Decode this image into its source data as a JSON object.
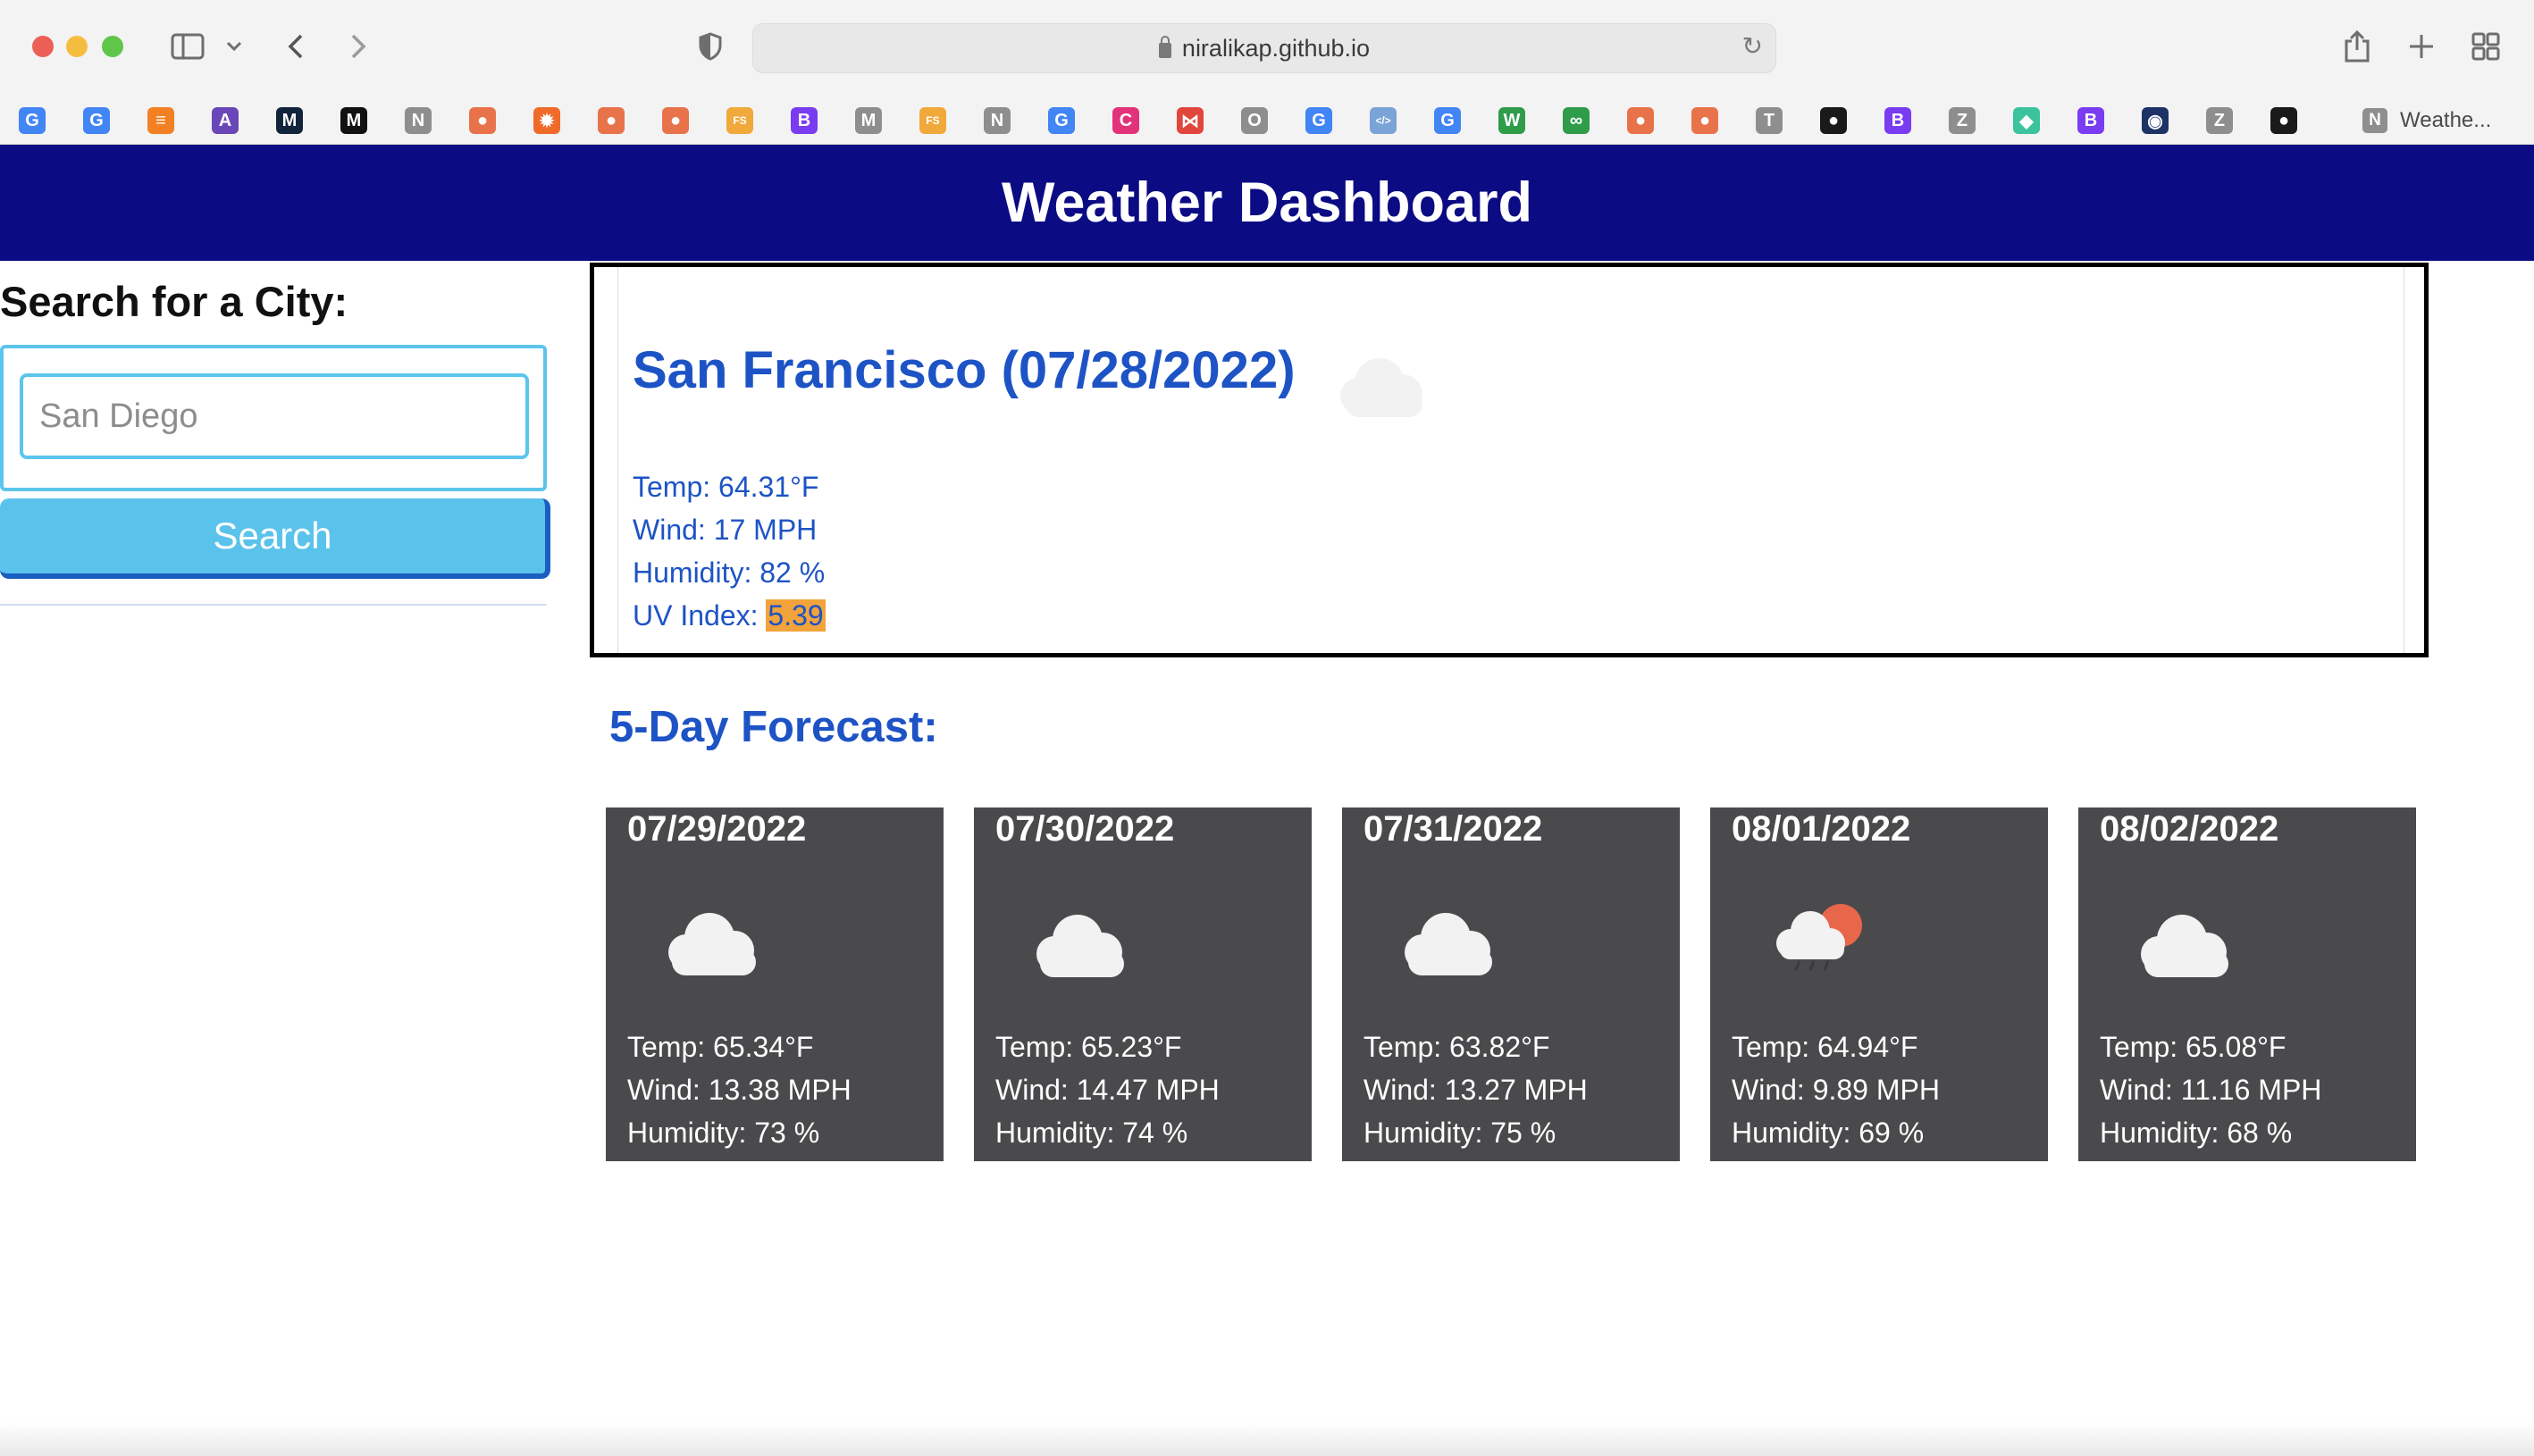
{
  "browser": {
    "url": "niralikap.github.io",
    "tab_title": "Weathe...",
    "tab_icon_letter": "N",
    "bookmarks": [
      {
        "letter": "G",
        "color": "#4285f4"
      },
      {
        "letter": "G",
        "color": "#4285f4"
      },
      {
        "letter": "≡",
        "color": "#f48024"
      },
      {
        "letter": "A",
        "color": "#6a47b8"
      },
      {
        "letter": "M",
        "color": "#12243b"
      },
      {
        "letter": "M",
        "color": "#111111"
      },
      {
        "letter": "N",
        "color": "#8e8e8e"
      },
      {
        "letter": "●",
        "color": "#e8734a"
      },
      {
        "letter": "✹",
        "color": "#f06a2a"
      },
      {
        "letter": "●",
        "color": "#e8734a"
      },
      {
        "letter": "●",
        "color": "#e8734a"
      },
      {
        "letter": "FS",
        "color": "#f0a93a"
      },
      {
        "letter": "B",
        "color": "#7a3cf0"
      },
      {
        "letter": "M",
        "color": "#8e8e8e"
      },
      {
        "letter": "FS",
        "color": "#f0a93a"
      },
      {
        "letter": "N",
        "color": "#8e8e8e"
      },
      {
        "letter": "G",
        "color": "#4285f4"
      },
      {
        "letter": "C",
        "color": "#e2337a"
      },
      {
        "letter": "⋈",
        "color": "#e0463c"
      },
      {
        "letter": "O",
        "color": "#8e8e8e"
      },
      {
        "letter": "G",
        "color": "#4285f4"
      },
      {
        "letter": "</>",
        "color": "#7aa3d8"
      },
      {
        "letter": "G",
        "color": "#4285f4"
      },
      {
        "letter": "W",
        "color": "#2f9c4a"
      },
      {
        "letter": "∞",
        "color": "#2f9c4a"
      },
      {
        "letter": "●",
        "color": "#e8734a"
      },
      {
        "letter": "●",
        "color": "#e8734a"
      },
      {
        "letter": "T",
        "color": "#8e8e8e"
      },
      {
        "letter": "●",
        "color": "#1a1a1a"
      },
      {
        "letter": "B",
        "color": "#7a3cf0"
      },
      {
        "letter": "Z",
        "color": "#8e8e8e"
      },
      {
        "letter": "◆",
        "color": "#3cc29c"
      },
      {
        "letter": "B",
        "color": "#7a3cf0"
      },
      {
        "letter": "◉",
        "color": "#1d3366"
      },
      {
        "letter": "Z",
        "color": "#8e8e8e"
      },
      {
        "letter": "●",
        "color": "#1a1a1a"
      }
    ]
  },
  "header": {
    "title": "Weather Dashboard"
  },
  "search": {
    "heading": "Search for a City:",
    "placeholder": "San Diego",
    "button_label": "Search"
  },
  "current": {
    "title": "San Francisco (07/28/2022)",
    "icon": "cloud-icon",
    "temp": "Temp: 64.31°F",
    "wind": "Wind: 17 MPH",
    "humidity": "Humidity: 82 %",
    "uv_label": "UV Index: ",
    "uv_value": "5.39"
  },
  "forecast": {
    "heading": "5-Day Forecast:",
    "days": [
      {
        "date": "07/29/2022",
        "icon": "cloud-icon",
        "temp": "Temp: 65.34°F",
        "wind": "Wind: 13.38 MPH",
        "humidity": "Humidity: 73 %"
      },
      {
        "date": "07/30/2022",
        "icon": "cloud-icon",
        "temp": "Temp: 65.23°F",
        "wind": "Wind: 14.47 MPH",
        "humidity": "Humidity: 74 %"
      },
      {
        "date": "07/31/2022",
        "icon": "cloud-icon",
        "temp": "Temp: 63.82°F",
        "wind": "Wind: 13.27 MPH",
        "humidity": "Humidity: 75 %"
      },
      {
        "date": "08/01/2022",
        "icon": "sun-rain-cloud-icon",
        "temp": "Temp: 64.94°F",
        "wind": "Wind: 9.89 MPH",
        "humidity": "Humidity: 69 %"
      },
      {
        "date": "08/02/2022",
        "icon": "cloud-icon",
        "temp": "Temp: 65.08°F",
        "wind": "Wind: 11.16 MPH",
        "humidity": "Humidity: 68 %"
      }
    ]
  },
  "colors": {
    "header_bg": "#0b0b84",
    "accent_blue": "#1d53c5",
    "search_button": "#5ac3ec",
    "uv_highlight": "#f2a33b",
    "card_bg": "#4a4a4c"
  }
}
